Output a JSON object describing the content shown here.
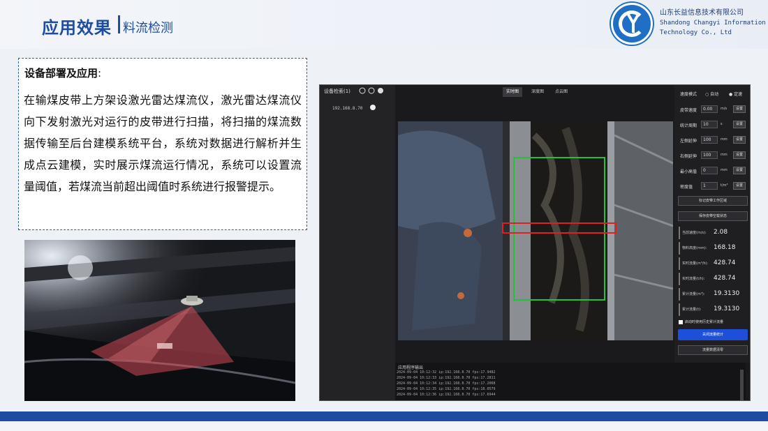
{
  "header": {
    "title_main": "应用效果",
    "title_sub": "料流检测",
    "company_cn": "山东长益信息技术有限公司",
    "company_en_1": "Shandong Changyi Information",
    "company_en_2": "Technology Co., Ltd",
    "brand_color": "#1e4da0"
  },
  "textbox": {
    "heading": "设备部署及应用",
    "colon": ":",
    "body": "在输煤皮带上方架设激光雷达煤流仪，激光雷达煤流仪向下发射激光对运行的皮带进行扫描，将扫描的煤流数据传输至后台建模系统平台，系统对数据进行解析并生成点云建模，实时展示煤流运行情况，系统可以设置流量阈值，若煤流当前超出阈值时系统进行报警提示。"
  },
  "app": {
    "device_list_title": "设备检索(1)",
    "device_ip": "192.168.8.70",
    "tabs": [
      "实时图",
      "深度图",
      "点云图"
    ],
    "mode_label": "速度模式",
    "mode_auto": "自动",
    "mode_fixed": "定速",
    "fields": [
      {
        "label": "皮带速度",
        "value": "0.00",
        "unit": "m/s",
        "btn": "设置"
      },
      {
        "label": "统计周期",
        "value": "10",
        "unit": "s",
        "btn": "设置"
      },
      {
        "label": "左侧延伸",
        "value": "100",
        "unit": "mm",
        "btn": "设置"
      },
      {
        "label": "右侧延伸",
        "value": "100",
        "unit": "mm",
        "btn": "设置"
      },
      {
        "label": "最小高值",
        "value": "0",
        "unit": "mm",
        "btn": "设置"
      },
      {
        "label": "密度值",
        "value": "1",
        "unit": "t/m³",
        "btn": "设置"
      }
    ],
    "btn_set_area": "标记皮带工作区域",
    "btn_save_empty": "保存皮带空载状态",
    "metrics": [
      {
        "label": "当前速度(m/s):",
        "value": "2.08"
      },
      {
        "label": "物料高度(mm):",
        "value": "168.18"
      },
      {
        "label": "实时流量(m³/h):",
        "value": "428.74"
      },
      {
        "label": "实时流量(t/h):",
        "value": "428.74"
      },
      {
        "label": "累计流量(m³):",
        "value": "19.3130"
      },
      {
        "label": "累计流量(t):",
        "value": "19.3130"
      }
    ],
    "check_label": "启动时使用历史累计流量",
    "btn_stop": "关闭流量统计",
    "btn_clear": "流量数据清零",
    "log_title": "应用程序输出",
    "log_lines": [
      "2024-09-04 10:12:32 ip:192.168.8.70 fps:17.9482",
      "2024-09-04 10:12:33 ip:192.168.8.70 fps:17.2811",
      "2024-09-04 10:12:34 ip:192.168.8.70 fps:17.2068",
      "2024-09-04 10:12:35 ip:192.168.8.70 fps:18.0579",
      "2024-09-04 10:12:36 ip:192.168.8.70 fps:17.6944"
    ]
  },
  "bottom_bar_color": "#1e4da0"
}
